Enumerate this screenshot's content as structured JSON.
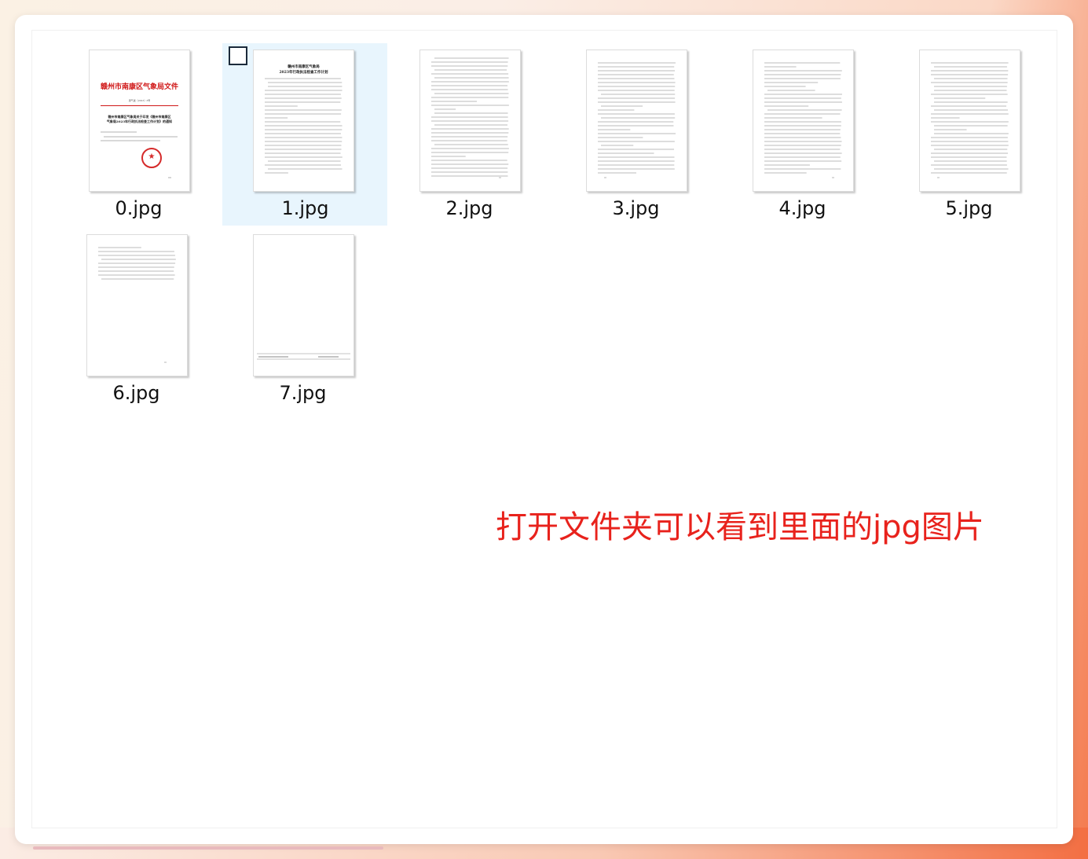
{
  "files": [
    {
      "name": "0.jpg"
    },
    {
      "name": "1.jpg"
    },
    {
      "name": "2.jpg"
    },
    {
      "name": "3.jpg"
    },
    {
      "name": "4.jpg"
    },
    {
      "name": "5.jpg"
    },
    {
      "name": "6.jpg"
    },
    {
      "name": "7.jpg"
    }
  ],
  "selected_file_index": 1,
  "annotation_text": "打开文件夹可以看到里面的jpg图片",
  "thumb_text": {
    "p0_header": "赣州市南康区气象局文件",
    "p0_docno": "康气发〔2023〕3号",
    "p0_title_1": "赣州市南康区气象局关于印发《赣州市南康区",
    "p0_title_2": "气象局2023年行政执法检查工作计划》的通知",
    "p1_title_1": "赣州市南康区气象局",
    "p1_title_2": "2023年行政执法检查工作计划"
  },
  "colors": {
    "annotation": "#e8221c",
    "red_header": "#d01818",
    "selection": "#e8f5fd"
  }
}
